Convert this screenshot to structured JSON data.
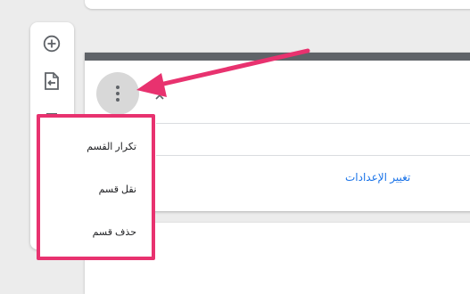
{
  "toolbar": {
    "buttons": [
      {
        "name": "add-question",
        "icon": "add-circle-icon"
      },
      {
        "name": "import-questions",
        "icon": "import-file-icon"
      },
      {
        "name": "add-title",
        "icon": "text-title-icon"
      }
    ]
  },
  "section": {
    "more_options_icon": "more-vert-icon",
    "collapse_icon": "collapse-icon",
    "settings_link": "تغيير الإعدادات"
  },
  "menu": {
    "items": [
      {
        "label": "تكرار القسم"
      },
      {
        "label": "نقل قسم"
      },
      {
        "label": "حذف قسم"
      }
    ]
  },
  "colors": {
    "highlight": "#e8326f",
    "link": "#1a73e8",
    "section_header": "#5f6368"
  }
}
